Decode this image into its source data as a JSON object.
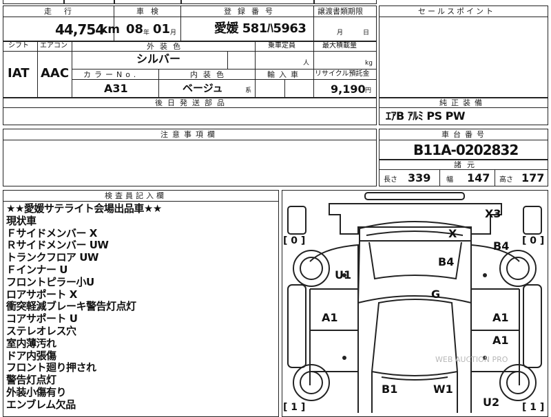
{
  "top_fragment": "",
  "mileage": {
    "label": "走行",
    "value": "44,754",
    "unit": "km"
  },
  "inspection": {
    "label": "車検",
    "year": "08",
    "year_unit": "年",
    "month": "01",
    "month_unit": "月"
  },
  "registration": {
    "label": "登録番号",
    "value": "愛媛 581ﾊ5963"
  },
  "transfer": {
    "label": "譲渡書類期限",
    "month_unit": "月",
    "day_unit": "日"
  },
  "sales_point": {
    "label": "セールスポイント"
  },
  "shift": {
    "label": "シフト",
    "value": "IAT"
  },
  "aircon": {
    "label": "エアコン",
    "value": "AAC"
  },
  "exterior_color": {
    "label": "外装色",
    "value": "シルバー"
  },
  "capacity": {
    "label": "乗車定員",
    "unit": "人"
  },
  "max_load": {
    "label": "最大積載量",
    "unit": "kg"
  },
  "color_no": {
    "label": "カラーNo.",
    "value": "A31"
  },
  "interior_color": {
    "label": "内装色",
    "value": "ベージュ",
    "suffix": "系"
  },
  "import": {
    "label": "輸入車"
  },
  "recycle": {
    "label": "リサイクル預託金",
    "value": "9,190",
    "unit": "円"
  },
  "later_parts": {
    "label": "後日発送部品"
  },
  "equipment": {
    "label": "純正装備",
    "value": "ｴｱB ｱﾙﾐ PS PW"
  },
  "notes": {
    "label": "注意事項欄"
  },
  "chassis": {
    "label": "車台番号",
    "value": "B11A-0202832"
  },
  "specs": {
    "label": "諸元",
    "length_label": "長さ",
    "length": "339",
    "width_label": "幅",
    "width": "147",
    "height_label": "高さ",
    "height": "177"
  },
  "inspector": {
    "label": "検査員記入欄",
    "lines": [
      "★★愛媛サテライト会場出品車★★",
      "現状車",
      "Ｆサイドメンバー X",
      "Ｒサイドメンバー UW",
      "トランクフロア UW",
      "Ｆインナー U",
      "フロントピラー小U",
      "ロアサポート X",
      "衝突軽減ブレーキ警告灯点灯",
      "コアサポート U",
      "ステレオレス穴",
      "室内薄汚れ",
      "ドア内張傷",
      "フロント廻り押され",
      "警告灯点灯",
      "外装小傷有り",
      "エンブレム欠品"
    ]
  },
  "diagram": {
    "marks": {
      "x3": "X3",
      "x": "X",
      "b4_right": "B4",
      "b4_center": "B4",
      "u1": "U1",
      "g": "G",
      "a1_left": "A1",
      "a1_right": "A1",
      "a1_right2": "A1",
      "b1": "B1",
      "w1": "W1",
      "u2": "U2"
    },
    "tire_counts": {
      "fl": "[ 0 ]",
      "fr": "[ 0 ]",
      "rl": "[ 1 ]",
      "rr": "[ 1 ]"
    },
    "watermark": "WEB AUCTION PRO"
  }
}
